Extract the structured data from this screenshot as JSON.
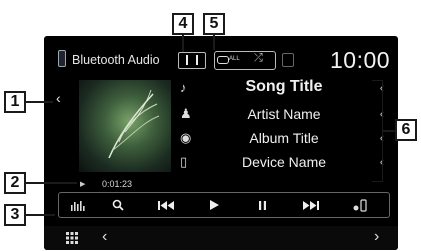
{
  "header": {
    "source_label": "Bluetooth Audio",
    "clock": "10:00",
    "repeat_label": "ALL"
  },
  "track": {
    "song_title": "Song Title",
    "artist_name": "Artist Name",
    "album_title": "Album Title",
    "device_name": "Device Name"
  },
  "playback": {
    "elapsed_time": "0:01:23"
  },
  "callouts": [
    "1",
    "2",
    "3",
    "4",
    "5",
    "6"
  ],
  "icons": {
    "menu": "grid-icon",
    "left_arrow": "chevron-left-icon",
    "right_arrow": "chevron-right-icon",
    "equalizer": "equalizer-icon",
    "search": "search-icon",
    "previous": "previous-track-icon",
    "play": "play-icon",
    "pause": "pause-icon",
    "next": "next-track-icon",
    "device": "bluetooth-device-icon"
  }
}
